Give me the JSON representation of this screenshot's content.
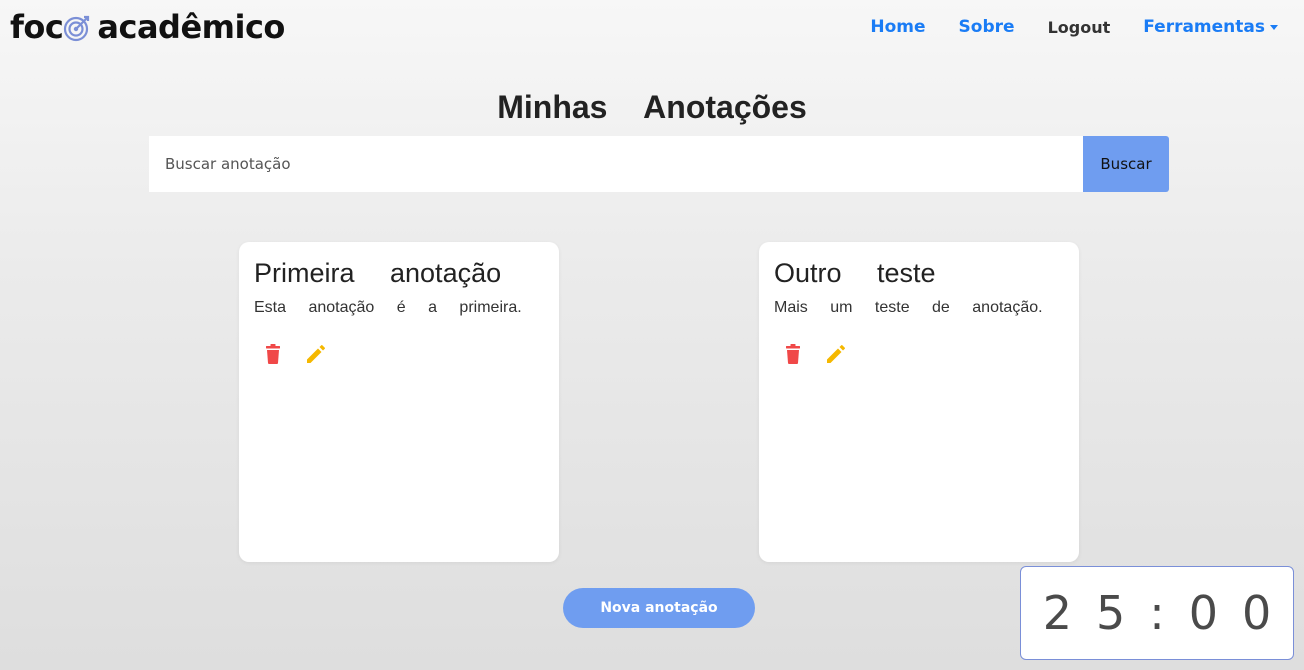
{
  "navbar": {
    "brand_prefix": "foc",
    "brand_suffix": "acadêmico",
    "links": [
      "Home",
      "Sobre",
      "Logout",
      "Ferramentas"
    ]
  },
  "page": {
    "title": "Minhas Anotações"
  },
  "search": {
    "placeholder": "Buscar anotação",
    "button_label": "Buscar"
  },
  "notes": [
    {
      "title": "Primeira anotação",
      "text": "Esta anotação é a primeira."
    },
    {
      "title": "Outro teste",
      "text": "Mais um teste de anotação."
    }
  ],
  "new_note_label": "Nova anotação",
  "timer": {
    "display": "25:00"
  },
  "colors": {
    "nav_link": "#1a7cf5",
    "accent_button": "#6f9df0",
    "delete_icon": "#f04848",
    "edit_icon": "#f5b800",
    "timer_border": "#7a8fd8"
  },
  "icons": [
    "target-icon",
    "trash-icon",
    "pencil-icon",
    "caret-down-icon"
  ]
}
